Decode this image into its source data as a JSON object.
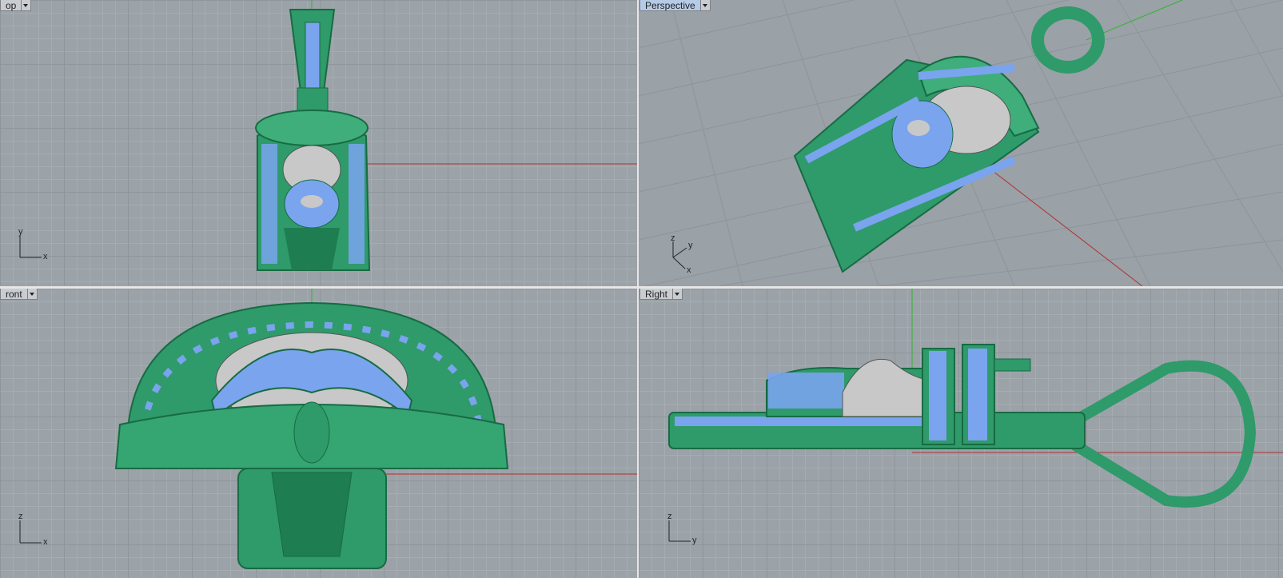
{
  "viewports": {
    "top": {
      "label": "op",
      "axis_a": "y",
      "axis_b": "x"
    },
    "perspective": {
      "label": "Perspective",
      "axis_z": "z",
      "axis_y": "y",
      "axis_x": "x"
    },
    "front": {
      "label": "ront",
      "axis_a": "z",
      "axis_b": "x"
    },
    "right": {
      "label": "Right",
      "axis_a": "z",
      "axis_b": "y"
    }
  },
  "colors": {
    "background": "#9ba2a8",
    "model_green": "#2f9a6a",
    "gem_blue": "#7aa4ee",
    "face_silver": "#c8c8c8",
    "x_axis": "#b23030",
    "y_axis": "#2fb52f",
    "active_tab": "#b5cbe6"
  }
}
